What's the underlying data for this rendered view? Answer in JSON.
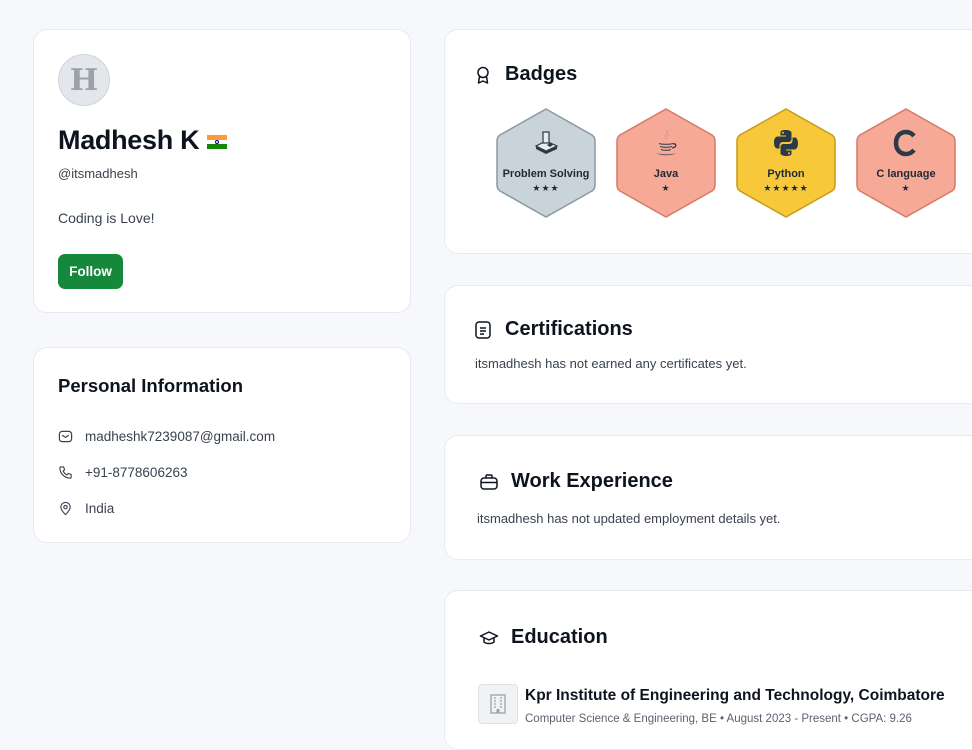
{
  "profile": {
    "avatar_letter": "H",
    "name": "Madhesh K",
    "flag": "india-flag",
    "username": "@itsmadhesh",
    "bio": "Coding is Love!",
    "follow_label": "Follow"
  },
  "personal_info": {
    "title": "Personal Information",
    "email": "madheshk7239087@gmail.com",
    "phone": "+91-8778606263",
    "location": "India"
  },
  "badges": {
    "title": "Badges",
    "items": [
      {
        "name": "Problem Solving",
        "stars": "★★★",
        "icon": "problem-solving-icon",
        "color": "#c9d3da"
      },
      {
        "name": "Java",
        "stars": "★",
        "icon": "java-icon",
        "color": "#f7a998"
      },
      {
        "name": "Python",
        "stars": "★★★★★",
        "icon": "python-icon",
        "color": "#f6c83a"
      },
      {
        "name": "C language",
        "stars": "★",
        "icon": "c-language-icon",
        "color": "#f7a998"
      }
    ]
  },
  "certifications": {
    "title": "Certifications",
    "note": "itsmadhesh has not earned any certificates yet."
  },
  "work": {
    "title": "Work Experience",
    "note": "itsmadhesh has not updated employment details yet."
  },
  "education": {
    "title": "Education",
    "institution": "Kpr Institute of Engineering and Technology, Coimbatore",
    "meta": "Computer Science & Engineering, BE  •  August 2023 - Present  •  CGPA: 9.26"
  },
  "colors": {
    "follow_button": "#16883c",
    "page_bg": "#f7f8fb"
  }
}
